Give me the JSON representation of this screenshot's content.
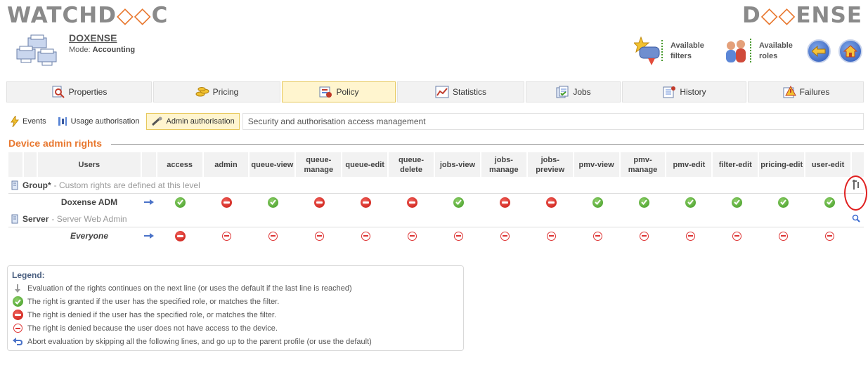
{
  "branding": {
    "left_logo_a": "WATCHD",
    "left_logo_mark": "⊙C",
    "left_logo_b": "",
    "right_logo_a": "D",
    "right_logo_mark": "◇◇",
    "right_logo_b": "ENSE"
  },
  "device": {
    "name": "DOXENSE",
    "mode_label": "Mode:",
    "mode_value": "Accounting"
  },
  "header_links": {
    "filters": "Available\nfilters",
    "roles": "Available\nroles"
  },
  "tabs": [
    {
      "label": "Properties",
      "icon": "magnifier-doc-icon",
      "active": false
    },
    {
      "label": "Pricing",
      "icon": "coins-icon",
      "active": false
    },
    {
      "label": "Policy",
      "icon": "policy-icon",
      "active": true
    },
    {
      "label": "Statistics",
      "icon": "chart-icon",
      "active": false
    },
    {
      "label": "Jobs",
      "icon": "jobs-icon",
      "active": false
    },
    {
      "label": "History",
      "icon": "history-icon",
      "active": false
    },
    {
      "label": "Failures",
      "icon": "warning-icon",
      "active": false
    }
  ],
  "subtabs": [
    {
      "label": "Events",
      "icon": "lightning-icon",
      "active": false
    },
    {
      "label": "Usage authorisation",
      "icon": "usage-icon",
      "active": false
    },
    {
      "label": "Admin authorisation",
      "icon": "admin-icon",
      "active": true
    }
  ],
  "subtab_description": "Security and authorisation access management",
  "section_title": "Device admin rights",
  "table": {
    "users_header": "Users",
    "columns": [
      "access",
      "admin",
      "queue-view",
      "queue-manage",
      "queue-edit",
      "queue-delete",
      "jobs-view",
      "jobs-manage",
      "jobs-preview",
      "pmv-view",
      "pmv-manage",
      "pmv-edit",
      "filter-edit",
      "pricing-edit",
      "user-edit"
    ],
    "columns_display": [
      "access",
      "admin",
      "queue-view",
      "queue-\nmanage",
      "queue-edit",
      "queue-\ndelete",
      "jobs-view",
      "jobs-\nmanage",
      "jobs-\npreview",
      "pmv-view",
      "pmv-\nmanage",
      "pmv-edit",
      "filter-edit",
      "pricing-edit",
      "user-edit"
    ],
    "groups": [
      {
        "title": "Group*",
        "desc": "- Custom rights are defined at this level",
        "rows": [
          {
            "user": "Doxense ADM",
            "italic": false,
            "rights": [
              "ok",
              "deny",
              "ok",
              "deny",
              "deny",
              "deny",
              "ok",
              "deny",
              "deny",
              "ok",
              "ok",
              "ok",
              "ok",
              "ok",
              "ok"
            ]
          }
        ]
      },
      {
        "title": "Server",
        "desc": "- Server Web Admin",
        "rows": [
          {
            "user": "Everyone",
            "italic": true,
            "rights": [
              "deny",
              "noacc",
              "noacc",
              "noacc",
              "noacc",
              "noacc",
              "noacc",
              "noacc",
              "noacc",
              "noacc",
              "noacc",
              "noacc",
              "noacc",
              "noacc",
              "noacc"
            ]
          }
        ]
      }
    ]
  },
  "legend": {
    "title": "Legend:",
    "items": [
      {
        "icon": "continue",
        "text": "Evaluation of the rights continues on the next line (or uses the default if the last line is reached)"
      },
      {
        "icon": "ok",
        "text": "The right is granted if the user has the specified role, or matches the filter."
      },
      {
        "icon": "deny",
        "text": "The right is denied if the user has the specified role, or matches the filter."
      },
      {
        "icon": "noacc",
        "text": "The right is denied because the user does not have access to the device."
      },
      {
        "icon": "abort",
        "text": "Abort evaluation by skipping all the following lines, and go up to the parent profile (or use the default)"
      }
    ]
  },
  "colors": {
    "accent": "#e8772e",
    "active_tab": "#fff5cf",
    "ok": "#3f9a22",
    "deny": "#c8170f"
  }
}
